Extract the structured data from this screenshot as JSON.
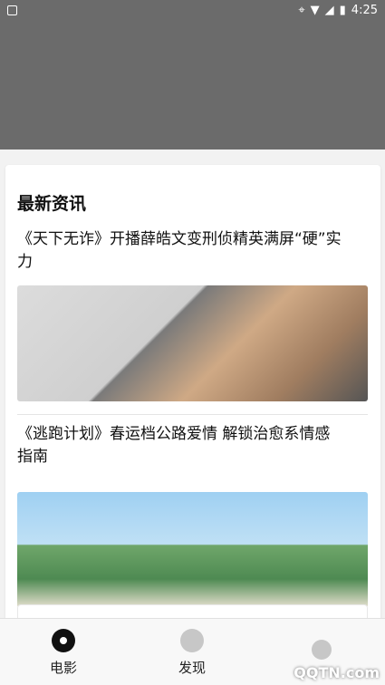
{
  "statusbar": {
    "time": "4:25",
    "icons": [
      "location-icon",
      "wifi-icon",
      "signal-icon",
      "battery-icon"
    ]
  },
  "section": {
    "title": "最新资讯"
  },
  "news": [
    {
      "title": "《天下无诈》开播薛皓文变刑侦精英满屏“硬”实力",
      "image": "news-thumbnail-1"
    },
    {
      "title": "《逃跑计划》春运档公路爱情 解锁治愈系情感指南",
      "image": "news-thumbnail-2"
    }
  ],
  "tabs": [
    {
      "label": "电影",
      "icon": "film-icon",
      "active": true
    },
    {
      "label": "发现",
      "icon": "discover-icon",
      "active": false
    },
    {
      "label": "",
      "icon": "user-icon",
      "active": false
    }
  ],
  "watermark": "QQTN.com"
}
